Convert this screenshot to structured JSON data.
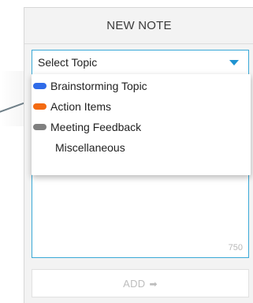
{
  "panel": {
    "title": "NEW NOTE"
  },
  "topic_select": {
    "selected_label": "Select Topic",
    "caret_icon": "caret-down-icon",
    "accent_color": "#1f93d1"
  },
  "dropdown": {
    "items": [
      {
        "label": "Brainstorming Topic",
        "color": "#2f6be8"
      },
      {
        "label": "Action Items",
        "color": "#f36a12"
      },
      {
        "label": "Meeting Feedback",
        "color": "#7f7f7f"
      },
      {
        "label": "Miscellaneous",
        "color": ""
      }
    ]
  },
  "editor": {
    "char_count": "750"
  },
  "add_button": {
    "label": "ADD",
    "icon": "arrow-right-icon",
    "arrow_glyph": "➡"
  }
}
